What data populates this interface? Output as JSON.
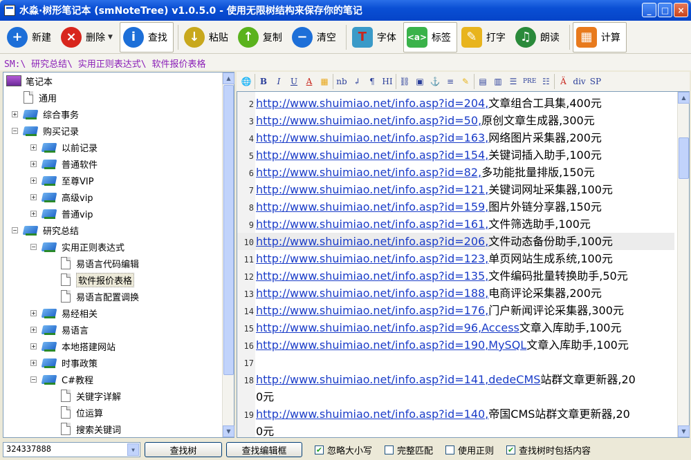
{
  "window": {
    "title": "水淼·树形笔记本 (smNoteTree) v1.0.5.0 - 使用无限树结构来保存你的笔记"
  },
  "toolbar": {
    "new_label": "新建",
    "delete_label": "删除",
    "find_label": "查找",
    "paste_label": "粘贴",
    "copy_label": "复制",
    "clear_label": "清空",
    "font_label": "字体",
    "tag_label": "标签",
    "type_label": "打字",
    "read_label": "朗读",
    "calc_label": "计算"
  },
  "path": "SM:\\ 研究总结\\ 实用正则表达式\\ 软件报价表格",
  "tree": [
    {
      "label": "笔记本",
      "icon": "monitor-icon",
      "level": 0,
      "exp": ""
    },
    {
      "label": "通用",
      "icon": "doc-icon",
      "level": 1,
      "exp": ""
    },
    {
      "label": "综合事务",
      "icon": "book-icon",
      "level": 1,
      "exp": "+"
    },
    {
      "label": "购买记录",
      "icon": "book-icon",
      "level": 1,
      "exp": "−"
    },
    {
      "label": "以前记录",
      "icon": "book-icon",
      "level": 2,
      "exp": "+"
    },
    {
      "label": "普通软件",
      "icon": "book-icon",
      "level": 2,
      "exp": "+"
    },
    {
      "label": "至尊VIP",
      "icon": "book-icon",
      "level": 2,
      "exp": "+"
    },
    {
      "label": "高级vip",
      "icon": "book-icon",
      "level": 2,
      "exp": "+"
    },
    {
      "label": "普通vip",
      "icon": "book-icon",
      "level": 2,
      "exp": "+"
    },
    {
      "label": "研究总结",
      "icon": "book-icon",
      "level": 1,
      "exp": "−"
    },
    {
      "label": "实用正则表达式",
      "icon": "book-icon",
      "level": 2,
      "exp": "−"
    },
    {
      "label": "易语言代码编辑",
      "icon": "doc-icon",
      "level": 3,
      "exp": ""
    },
    {
      "label": "软件报价表格",
      "icon": "doc-icon",
      "level": 3,
      "exp": "",
      "selected": true
    },
    {
      "label": "易语言配置调换",
      "icon": "doc-icon",
      "level": 3,
      "exp": ""
    },
    {
      "label": "易经相关",
      "icon": "book-icon",
      "level": 2,
      "exp": "+"
    },
    {
      "label": "易语言",
      "icon": "book-icon",
      "level": 2,
      "exp": "+"
    },
    {
      "label": "本地搭建网站",
      "icon": "book-icon",
      "level": 2,
      "exp": "+"
    },
    {
      "label": "时事政策",
      "icon": "book-icon",
      "level": 2,
      "exp": "+"
    },
    {
      "label": "C#教程",
      "icon": "book-icon",
      "level": 2,
      "exp": "−"
    },
    {
      "label": "关键字详解",
      "icon": "doc-icon",
      "level": 3,
      "exp": ""
    },
    {
      "label": "位运算",
      "icon": "doc-icon",
      "level": 3,
      "exp": ""
    },
    {
      "label": "搜索关键词",
      "icon": "doc-icon",
      "level": 3,
      "exp": ""
    }
  ],
  "editor_toolbar": [
    "B",
    "I",
    "U",
    "A",
    "nb",
    "¶",
    "HI",
    "PRE",
    "div",
    "SP"
  ],
  "lines": [
    {
      "num": "2",
      "link": "http://www.shuimiao.net/info.asp?id=204,",
      "text": "文章组合工具集,400元"
    },
    {
      "num": "3",
      "link": "http://www.shuimiao.net/info.asp?id=50,",
      "text": "原创文章生成器,300元"
    },
    {
      "num": "4",
      "link": "http://www.shuimiao.net/info.asp?id=163,",
      "text": "网络图片采集器,200元"
    },
    {
      "num": "5",
      "link": "http://www.shuimiao.net/info.asp?id=154,",
      "text": "关键词插入助手,100元"
    },
    {
      "num": "6",
      "link": "http://www.shuimiao.net/info.asp?id=82,",
      "text": "多功能批量排版,150元"
    },
    {
      "num": "7",
      "link": "http://www.shuimiao.net/info.asp?id=121,",
      "text": "关键词网址采集器,100元"
    },
    {
      "num": "8",
      "link": "http://www.shuimiao.net/info.asp?id=159,",
      "text": "图片外链分享器,150元"
    },
    {
      "num": "9",
      "link": "http://www.shuimiao.net/info.asp?id=161,",
      "text": "文件筛选助手,100元"
    },
    {
      "num": "10",
      "link": "http://www.shuimiao.net/info.asp?id=206,",
      "text": "文件动态备份助手,100元",
      "highlight": true
    },
    {
      "num": "11",
      "link": "http://www.shuimiao.net/info.asp?id=123,",
      "text": "单页网站生成系统,100元"
    },
    {
      "num": "12",
      "link": "http://www.shuimiao.net/info.asp?id=135,",
      "text": "文件编码批量转换助手,50元"
    },
    {
      "num": "13",
      "link": "http://www.shuimiao.net/info.asp?id=188,",
      "text": "电商评论采集器,200元"
    },
    {
      "num": "14",
      "link": "http://www.shuimiao.net/info.asp?id=176,",
      "text": "门户新闻评论采集器,300元"
    },
    {
      "num": "15",
      "link": "http://www.shuimiao.net/info.asp?id=96,Access",
      "text": "文章入库助手,100元"
    },
    {
      "num": "16",
      "link": "http://www.shuimiao.net/info.asp?id=190,MySQL",
      "text": "文章入库助手,100元"
    },
    {
      "num": "17",
      "link": "",
      "text": ""
    },
    {
      "num": "18",
      "link": "http://www.shuimiao.net/info.asp?id=141,dedeCMS",
      "text": "站群文章更新器,20"
    },
    {
      "num": "",
      "link": "",
      "text": "0元"
    },
    {
      "num": "19",
      "link": "http://www.shuimiao.net/info.asp?id=140,",
      "text": "帝国CMS站群文章更新器,20"
    },
    {
      "num": "",
      "link": "",
      "text": "0元"
    }
  ],
  "status": {
    "combo_value": "324337888",
    "find_tree_label": "查找树",
    "find_editor_label": "查找编辑框",
    "ignore_case_label": "忽略大小写",
    "ignore_case_checked": true,
    "whole_match_label": "完整匹配",
    "whole_match_checked": false,
    "regex_label": "使用正则",
    "regex_checked": false,
    "search_content_label": "查找树时包括内容",
    "search_content_checked": true
  },
  "colors": {
    "path_text": "#8b1fb8",
    "link": "#1a3cc8",
    "titlebar": "#0a4fd4"
  }
}
